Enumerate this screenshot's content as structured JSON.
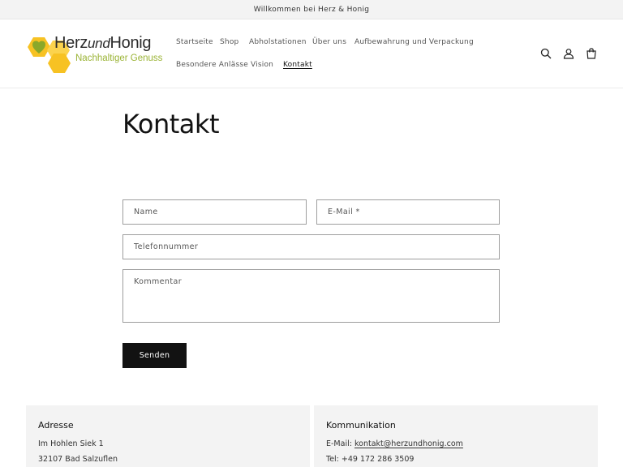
{
  "announcement": "Willkommen bei Herz & Honig",
  "logo": {
    "name_a": "Herz",
    "name_b": "und",
    "name_c": "Honig",
    "tagline": "Nachhaltiger Genuss"
  },
  "nav": {
    "startseite": "Startseite",
    "shop": "Shop",
    "abholstationen": "Abholstationen",
    "ueber_uns": "Über uns",
    "aufbewahrung": "Aufbewahrung und Verpackung",
    "anlaesse": "Besondere Anlässe",
    "vision": "Vision",
    "kontakt": "Kontakt"
  },
  "header_icons": [
    "search-icon",
    "account-icon",
    "cart-icon"
  ],
  "page_title": "Kontakt",
  "form": {
    "name_placeholder": "Name",
    "email_placeholder": "E-Mail *",
    "phone_placeholder": "Telefonnummer",
    "comment_placeholder": "Kommentar",
    "submit_label": "Senden"
  },
  "address": {
    "title": "Adresse",
    "street": "Im Hohlen Siek 1",
    "city": "32107 Bad Salzuflen"
  },
  "communication": {
    "title": "Kommunikation",
    "email_label": "E-Mail:",
    "email": "kontakt@herzundhonig.com",
    "phone": "Tel: +49 172 286 3509"
  },
  "colors": {
    "accent_green": "#9bb436",
    "honey": "#f7c223",
    "button": "#121212",
    "card_bg": "#f3f3f3"
  }
}
